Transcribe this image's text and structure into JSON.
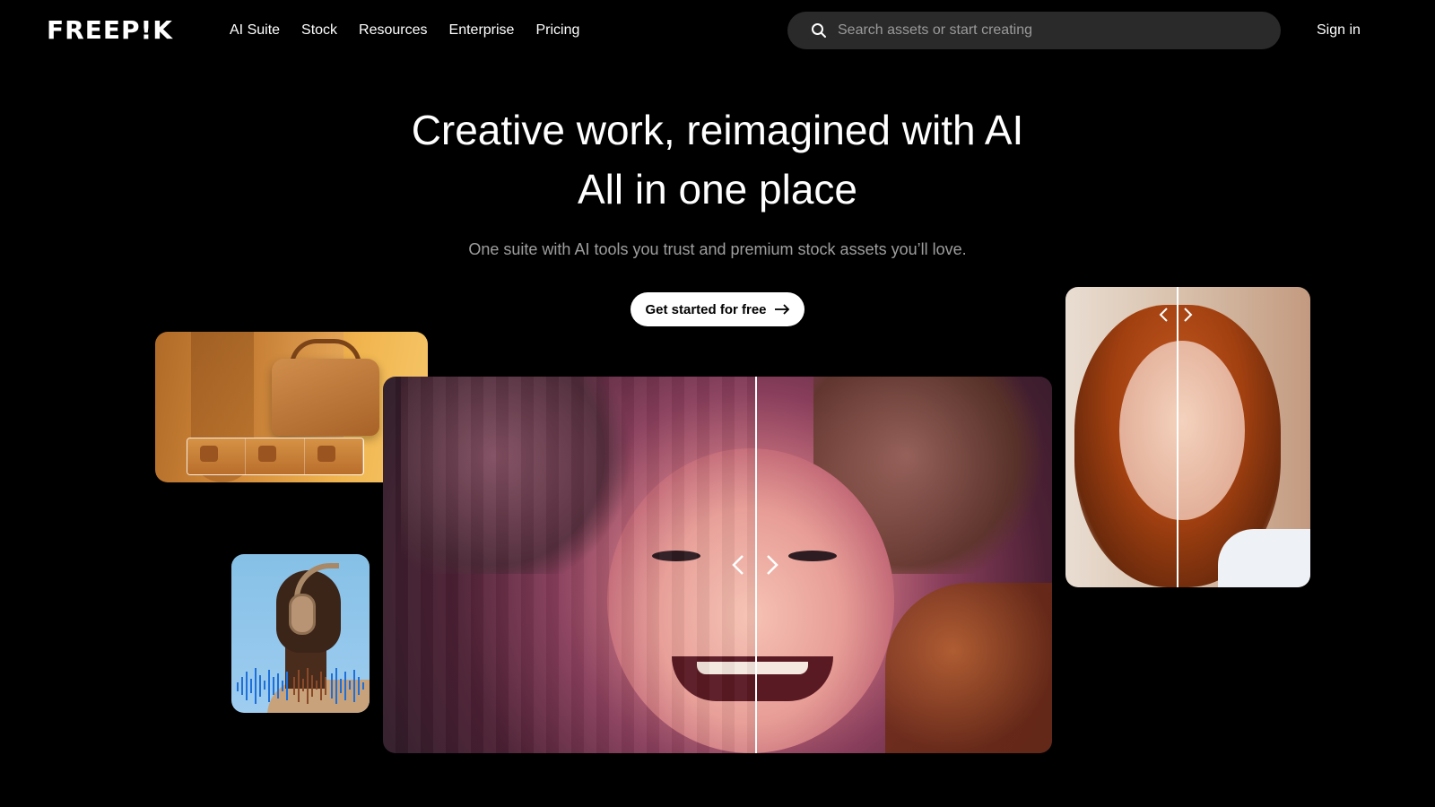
{
  "header": {
    "logo_text": "FREEP!K",
    "nav": [
      "AI Suite",
      "Stock",
      "Resources",
      "Enterprise",
      "Pricing"
    ],
    "search_placeholder": "Search assets or start creating",
    "signin_label": "Sign in"
  },
  "hero": {
    "title_line1": "Creative work, reimagined with AI",
    "title_line2": "All in one place",
    "subtitle": "One suite with AI tools you trust and premium stock assets you’ll love.",
    "cta_label": "Get started for free"
  },
  "icons": {
    "search": "search-icon",
    "cta_arrow": "arrow-right-icon",
    "compare_left": "chevron-left-icon",
    "compare_right": "chevron-right-icon"
  }
}
